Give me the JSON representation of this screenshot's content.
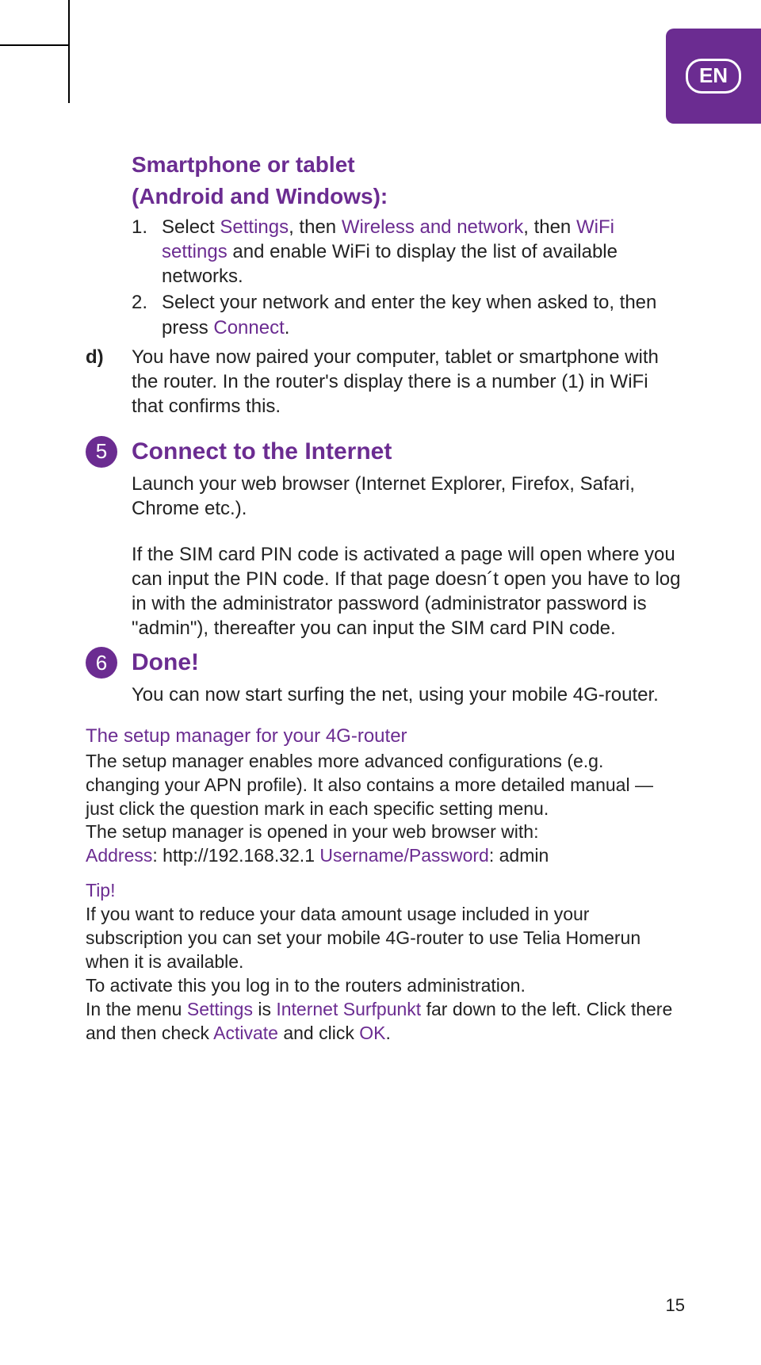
{
  "lang_badge": "EN",
  "heading_line1": "Smartphone or tablet",
  "heading_line2": "(Android and Windows):",
  "item1": {
    "num": "1.",
    "t1": "Select ",
    "settings": "Settings",
    "t2": ", then ",
    "wireless": "Wireless and network",
    "t3": ", then ",
    "wifi": "WiFi settings",
    "t4": " and enable WiFi to display the list of available networks."
  },
  "item2": {
    "num": "2.",
    "t1": "Select your network and enter the key when asked to, then press ",
    "connect": "Connect",
    "t2": "."
  },
  "d": {
    "marker": "d)",
    "text": "You have now paired your computer, tablet or smartphone with the router. In the router's display there is a number (1) in WiFi that confirms this."
  },
  "step5": {
    "num": "5",
    "title": "Connect to the Internet",
    "p1": "Launch your web browser (Internet Explorer, Firefox, Safari, Chrome etc.).",
    "p2": "If the SIM card PIN code is activated a page will open where you can input the PIN code. If that page doesn´t open you have to log in with the administrator password (administrator password is \"admin\"), thereafter you can input the SIM card PIN code."
  },
  "step6": {
    "num": "6",
    "title": "Done!",
    "p1": "You can now start surfing the net, using your mobile 4G-router."
  },
  "setup": {
    "heading": "The setup manager for your 4G-router",
    "body": "The setup manager enables more advanced configurations (e.g. changing your APN profile). It also contains a more detailed manual — just click the question mark in each specific setting menu.",
    "open": "The setup manager is opened in your web browser with:",
    "addr_label": "Address",
    "addr_val": ": http://192.168.32.1 ",
    "up_label": "Username/Password",
    "up_val": ": admin"
  },
  "tip": {
    "label": "Tip!",
    "l1": "If you want to reduce your data amount usage included in your subscription you can set your mobile 4G-router to use Telia Homerun when it is available.",
    "l2": "To activate this you log in to the routers administration.",
    "l3a": "In the menu ",
    "settings": "Settings",
    "l3b": " is ",
    "surfpunkt": "Internet Surfpunkt",
    "l3c": " far down to the left. Click there and then check ",
    "activate": "Activate",
    "l3d": " and click ",
    "ok": "OK",
    "l3e": "."
  },
  "page_number": "15"
}
